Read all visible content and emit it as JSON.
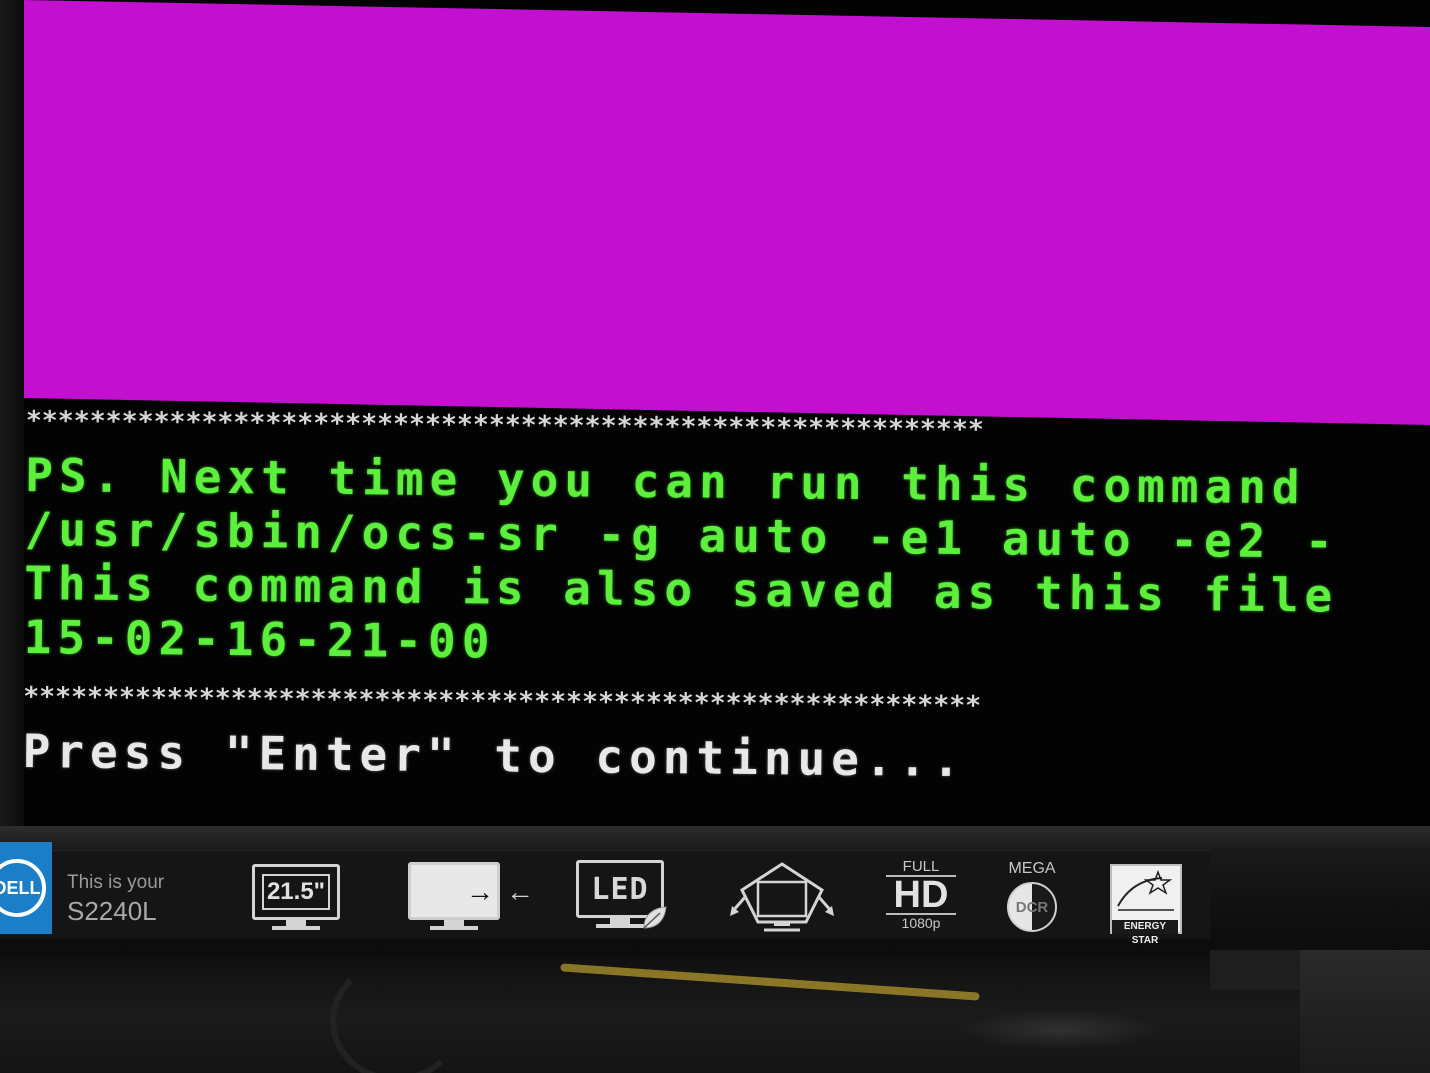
{
  "terminal": {
    "separator_top": "************************************************************",
    "line1": "PS. Next time you can run this command",
    "line2": "/usr/sbin/ocs-sr -g auto -e1 auto -e2 -",
    "line3": "This command is also saved as this file",
    "line4": "15-02-16-21-00",
    "separator_bottom": "************************************************************",
    "prompt": "Press \"Enter\" to continue..."
  },
  "colors": {
    "screen_background": "#c310d0",
    "terminal_green": "#5cf03c",
    "terminal_white": "#e8e8e8",
    "brand_blue": "#1a7ec8"
  },
  "bezel": {
    "brand_logo": "DELL",
    "model_line1": "This is your",
    "model_line2": "S2240L",
    "size_label": "21.5\"",
    "led_label": "LED",
    "full_label": "FULL",
    "hd_label": "HD",
    "resolution_label": "1080p",
    "mega_label": "MEGA",
    "dcr_label": "DCR",
    "energy_label": "ENERGY STAR",
    "icons": [
      "dell-logo-icon",
      "monitor-size-icon",
      "slim-monitor-icon",
      "led-monitor-icon",
      "tilt-monitor-icon",
      "full-hd-icon",
      "mega-dcr-icon",
      "energy-star-icon"
    ]
  }
}
